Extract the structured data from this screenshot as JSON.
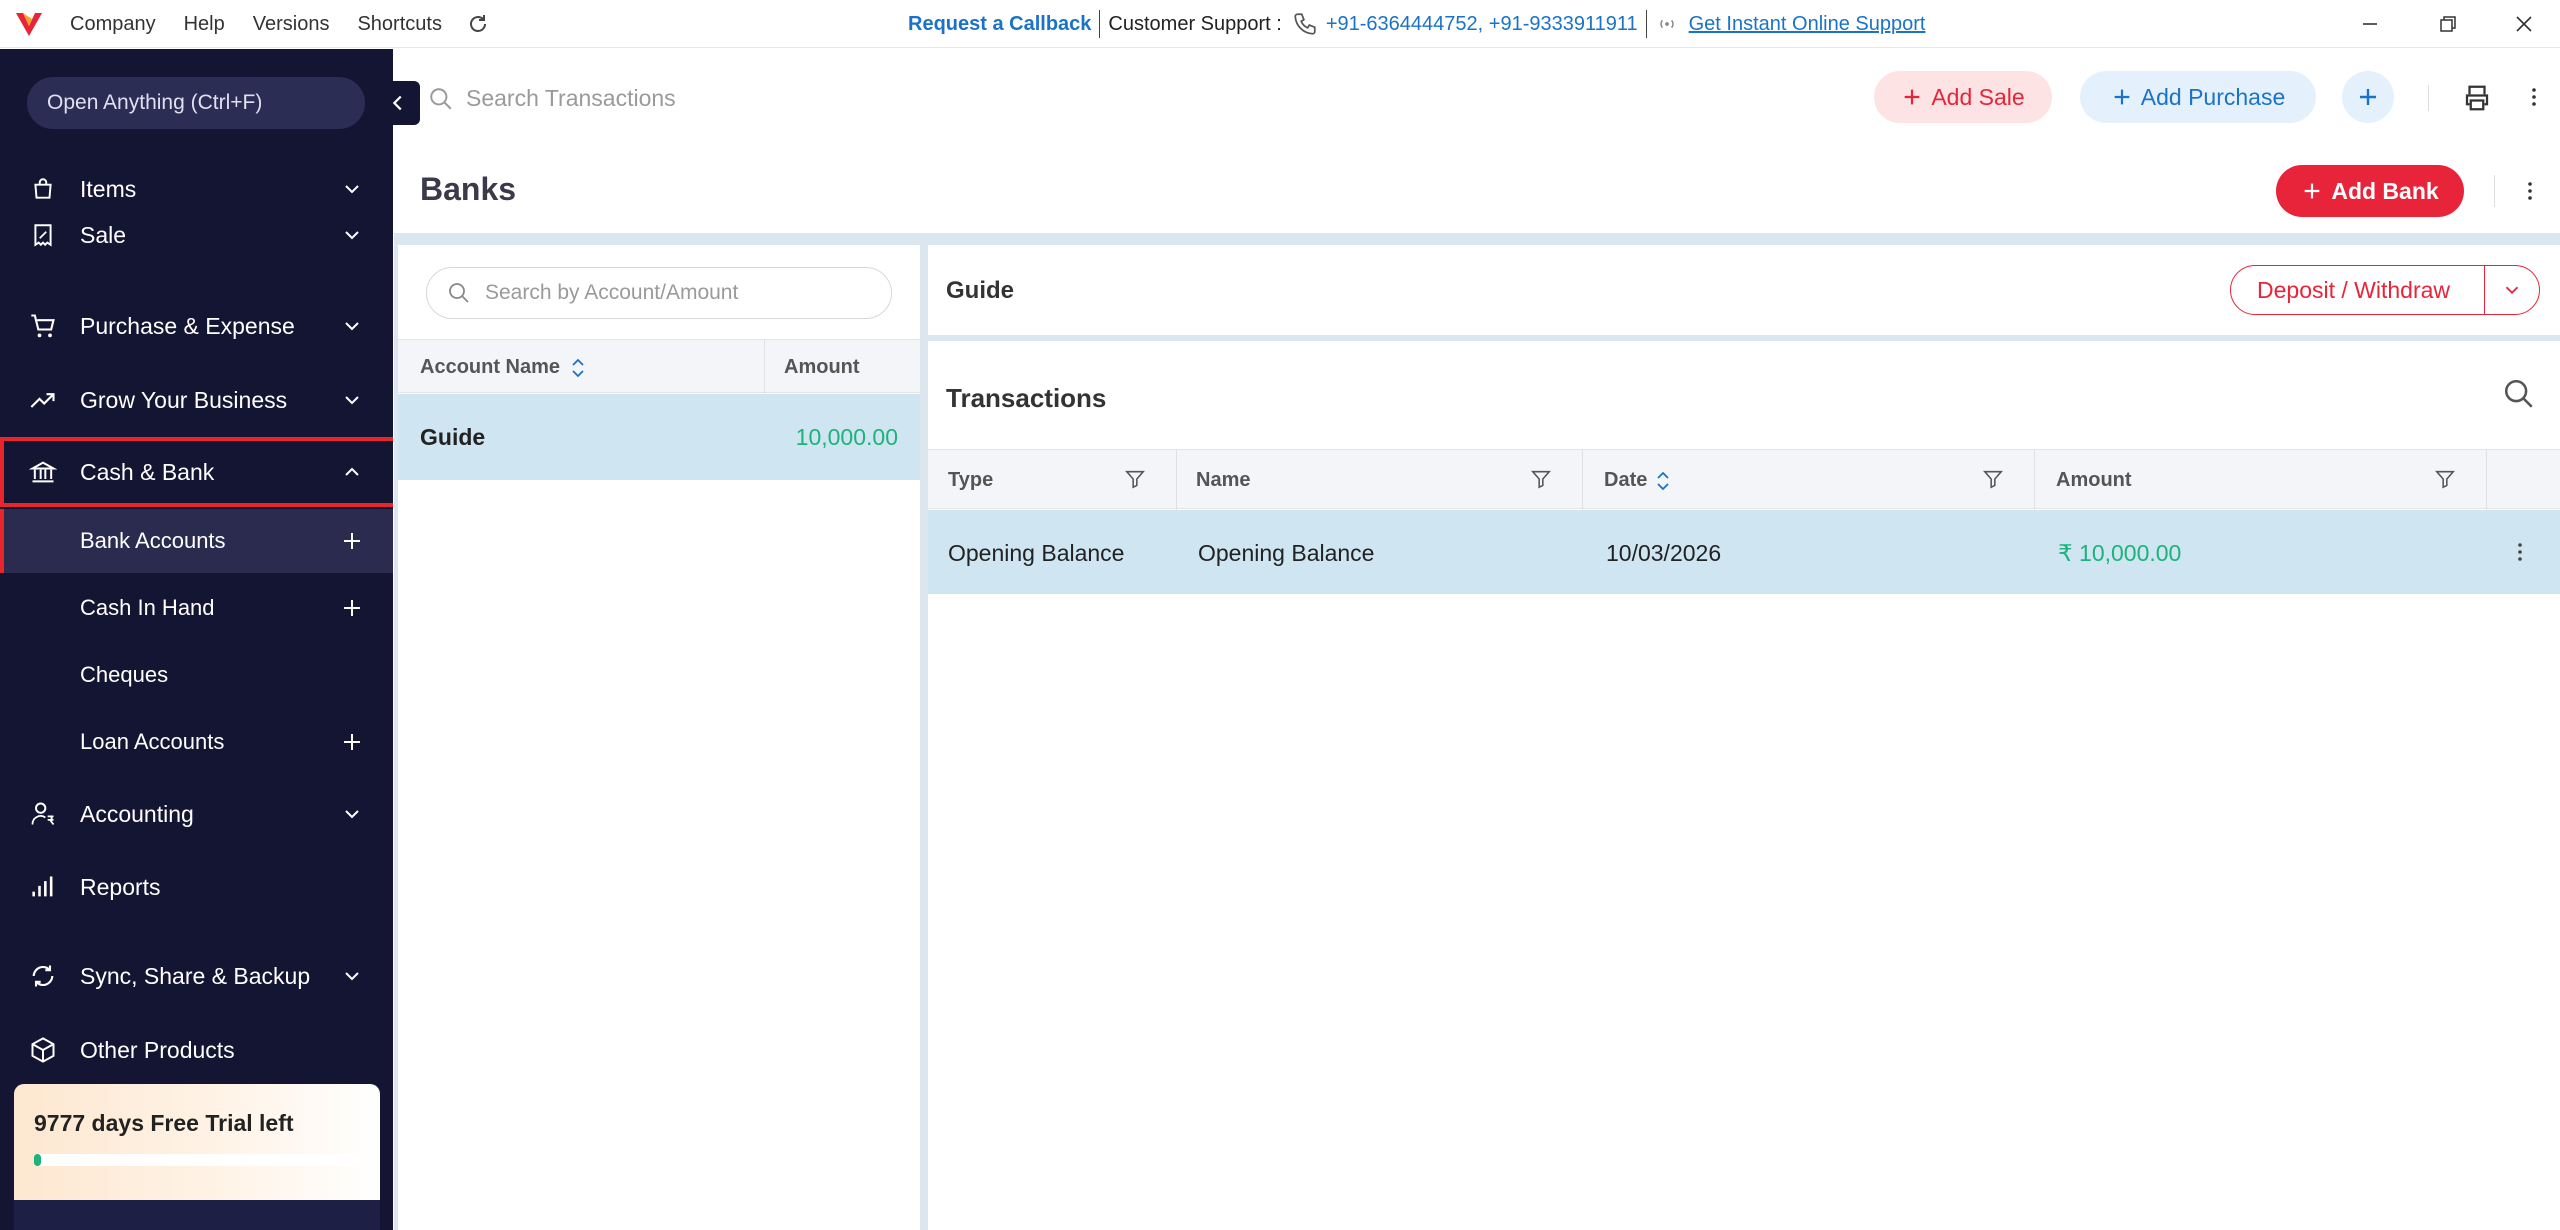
{
  "titlebar": {
    "menu": [
      "Company",
      "Help",
      "Versions",
      "Shortcuts"
    ],
    "request_callback": "Request a Callback",
    "customer_support_label": "Customer Support :",
    "phones": "+91-6364444752, +91-9333911911",
    "online_support": "Get Instant Online Support"
  },
  "sidebar": {
    "open_anything": "Open Anything (Ctrl+F)",
    "items": [
      {
        "label": "Items"
      },
      {
        "label": "Sale"
      },
      {
        "label": "Purchase & Expense"
      },
      {
        "label": "Grow Your Business"
      },
      {
        "label": "Cash & Bank"
      },
      {
        "label": "Accounting"
      },
      {
        "label": "Reports"
      },
      {
        "label": "Sync, Share & Backup"
      },
      {
        "label": "Other Products"
      }
    ],
    "sub_items": [
      {
        "label": "Bank Accounts"
      },
      {
        "label": "Cash In Hand"
      },
      {
        "label": "Cheques"
      },
      {
        "label": "Loan Accounts"
      }
    ],
    "trial": {
      "text": "9777 days Free Trial left",
      "progress_percent": 1
    }
  },
  "toolbar": {
    "search_placeholder": "Search Transactions",
    "add_sale": "Add Sale",
    "add_purchase": "Add Purchase"
  },
  "page": {
    "title": "Banks",
    "add_bank": "Add Bank"
  },
  "accounts": {
    "search_placeholder": "Search by Account/Amount",
    "columns": [
      "Account Name",
      "Amount"
    ],
    "rows": [
      {
        "name": "Guide",
        "amount": "10,000.00"
      }
    ]
  },
  "detail": {
    "account_name": "Guide",
    "deposit_withdraw": "Deposit / Withdraw",
    "transactions_title": "Transactions",
    "columns": [
      "Type",
      "Name",
      "Date",
      "Amount"
    ],
    "rows": [
      {
        "type": "Opening Balance",
        "name": "Opening Balance",
        "date": "10/03/2026",
        "amount": "₹ 10,000.00"
      }
    ]
  },
  "colors": {
    "sidebar_bg": "#141533",
    "accent_red": "#e8243a",
    "accent_blue": "#1a73c8",
    "amount_green": "#1db37a",
    "selected_row": "#cfe5f1"
  }
}
